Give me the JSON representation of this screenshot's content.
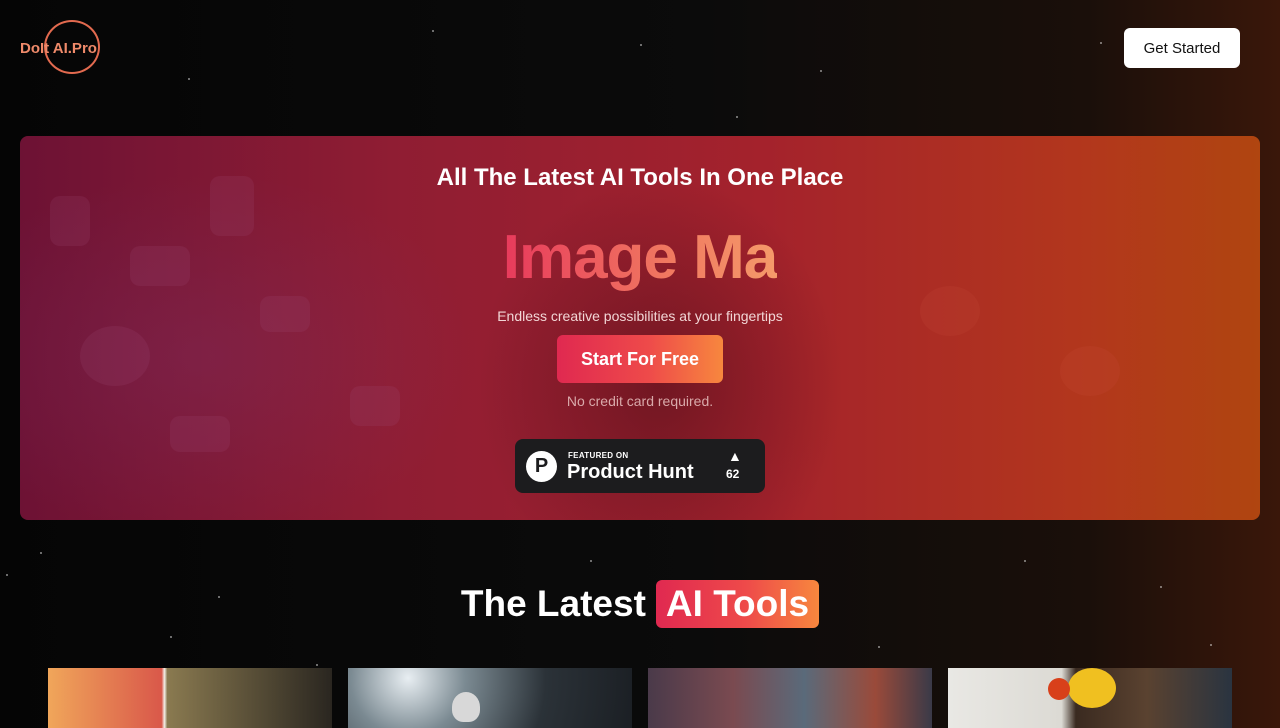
{
  "header": {
    "logo_text": "DoIt AI.Pro",
    "cta_label": "Get Started"
  },
  "hero": {
    "title": "All The Latest AI Tools In One Place",
    "typed_text": "Image Ma",
    "subtitle": "Endless creative possibilities at your fingertips",
    "start_label": "Start For Free",
    "note": "No credit card required."
  },
  "product_hunt": {
    "featured_label": "FEATURED ON",
    "name": "Product Hunt",
    "logo_letter": "P",
    "arrow": "▲",
    "votes": "62"
  },
  "section": {
    "title_plain": "The Latest",
    "title_highlight": "AI Tools"
  },
  "colors": {
    "accent_start": "#e02950",
    "accent_end": "#f7873e",
    "hero_left": "#6d1234",
    "hero_right": "#b04510"
  }
}
